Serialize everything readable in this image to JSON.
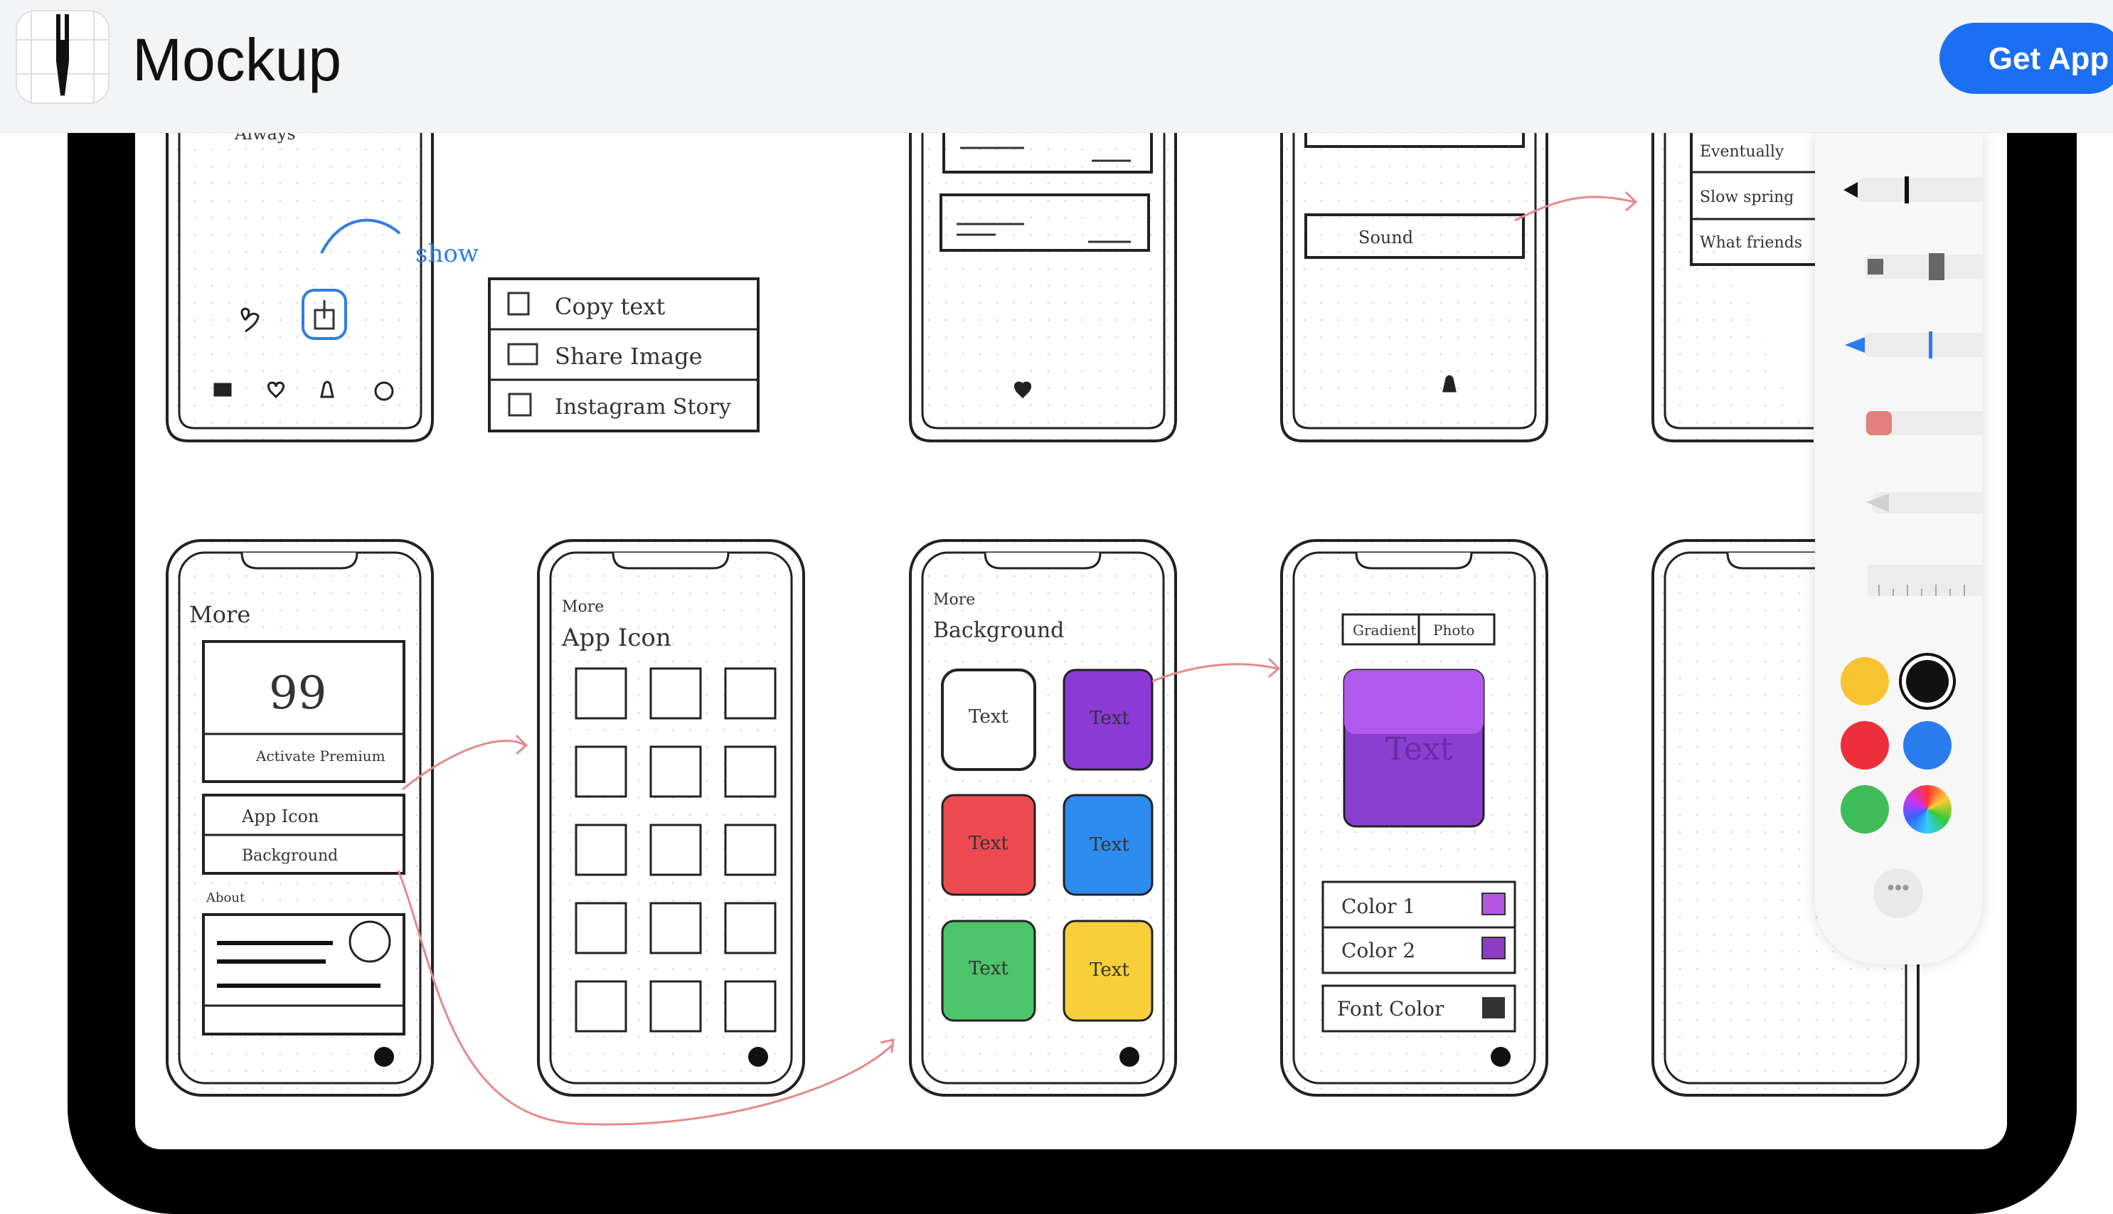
{
  "banner": {
    "app_name": "Mockup",
    "get_app_label": "Get App"
  },
  "colors": {
    "brand_button": "#1b6ff2",
    "swatches": [
      "#f7c331",
      "#111111",
      "#ec2f3b",
      "#2a7cf0",
      "#3fbd5a",
      "rainbow"
    ],
    "sketch_accent_blue": "#2f7fe0",
    "sketch_arrow_red": "#e58a8a"
  },
  "sketch": {
    "show_label": "show",
    "menu_items": [
      "Copy text",
      "Share Image",
      "Instagram Story"
    ],
    "partial_top": [
      "Always",
      "Sound"
    ],
    "partial_right": [
      "Eventually",
      "Slow spring",
      "What friends"
    ],
    "more_title": "More",
    "more_quote": "99",
    "more_premium": "Activate Premium",
    "more_rows": [
      "App Icon",
      "Background"
    ],
    "more_about": "About",
    "app_icon_back": "More",
    "app_icon_title": "App Icon",
    "bg_back": "More",
    "bg_title": "Background",
    "card_text": "Text",
    "tabs": [
      "Gradient",
      "Photo"
    ],
    "preview_text": "Text",
    "color_rows": [
      "Color 1",
      "Color 2",
      "Font Color"
    ]
  },
  "palette": {
    "tools": [
      "pen-icon",
      "marker-icon",
      "pencil-icon",
      "eraser-icon",
      "lasso-icon",
      "ruler-icon"
    ],
    "more_label": "•••"
  }
}
